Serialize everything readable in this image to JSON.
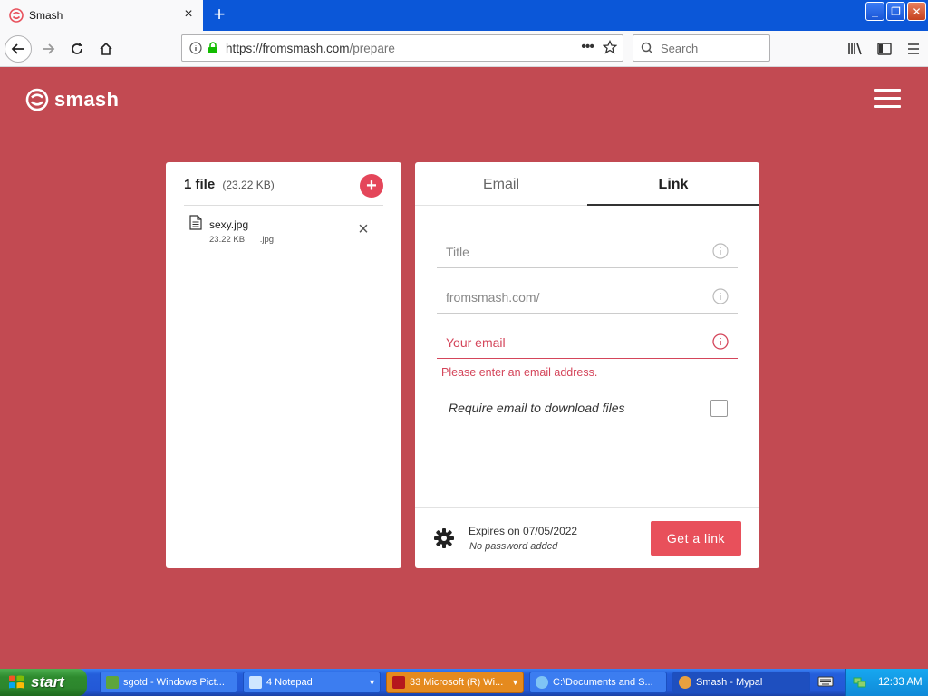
{
  "browser": {
    "tab_title": "Smash",
    "url_main": "https://fromsmash.com",
    "url_path": "/prepare",
    "search_placeholder": "Search"
  },
  "app": {
    "logo_text": "smash",
    "files": {
      "count_label": "1 file",
      "total_size": "(23.22 KB)",
      "items": [
        {
          "name": "sexy.jpg",
          "size": "23.22 KB",
          "ext": ".jpg"
        }
      ]
    },
    "tabs": {
      "email": "Email",
      "link": "Link"
    },
    "form": {
      "title_placeholder": "Title",
      "url_placeholder": "fromsmash.com/",
      "email_placeholder": "Your email",
      "error_message": "Please enter an email address.",
      "require_email_label": "Require email to download files",
      "expires": "Expires on 07/05/2022",
      "password": "No password addcd",
      "get_link": "Get a link"
    },
    "colors": {
      "page_background": "#c24a52",
      "accent": "#e8505b",
      "error": "#d4455a"
    }
  },
  "taskbar": {
    "start_label": "start",
    "items": [
      {
        "label": "sgotd - Windows Pict..."
      },
      {
        "label": "4 Notepad"
      },
      {
        "label": "33 Microsoft (R) Wi..."
      },
      {
        "label": "C:\\Documents and S..."
      },
      {
        "label": "Smash - Mypal"
      }
    ],
    "clock": "12:33 AM"
  }
}
